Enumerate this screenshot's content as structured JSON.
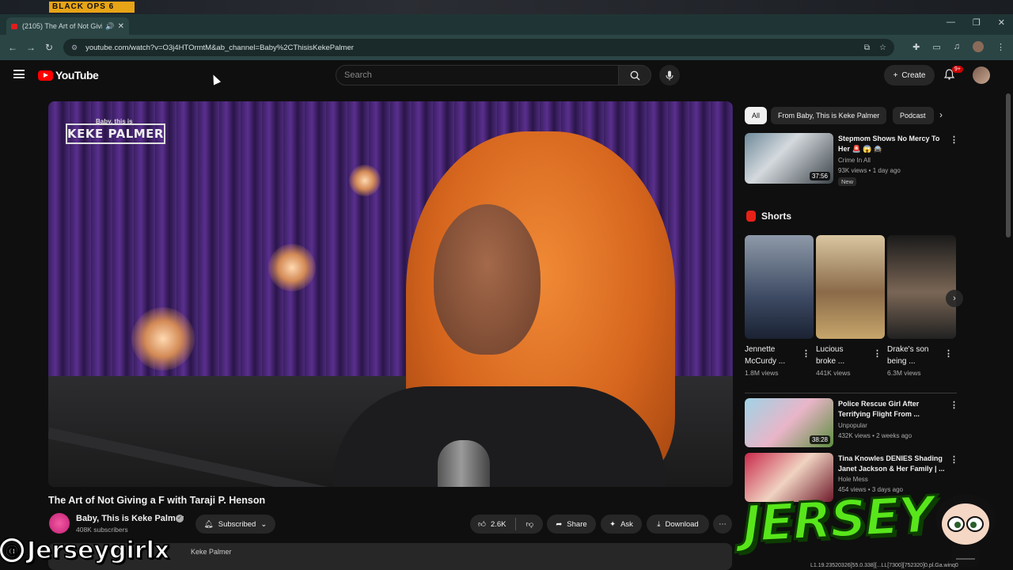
{
  "desktop": {
    "game_logo": "BLACK OPS 6"
  },
  "browser": {
    "tab_title": "(2105) The Art of Not Giving",
    "url": "youtube.com/watch?v=O3j4HTOrmtM&ab_channel=Baby%2CThisisKekePalmer"
  },
  "yt_header": {
    "logo_text": "YouTube",
    "search_placeholder": "Search",
    "create_label": "Create",
    "notification_count": "9+"
  },
  "player": {
    "logo_super": "Baby, this is",
    "logo_main": "KEKE PALMER"
  },
  "video": {
    "title": "The Art of Not Giving a F with Taraji P. Henson",
    "channel_name": "Baby, This is Keke Palmer",
    "subscribers": "408K subscribers",
    "subscribed_label": "Subscribed",
    "likes": "2.6K",
    "share_label": "Share",
    "ask_label": "Ask",
    "download_label": "Download",
    "description_snippet": "Keke Palmer"
  },
  "chips": [
    "All",
    "From Baby, This is Keke Palmer",
    "Podcast"
  ],
  "recommendations": [
    {
      "title_line1": "Stepmom Shows No Mercy To",
      "title_line2": "Her 🚨 😱 🚔",
      "channel": "Crime In All",
      "meta": "93K views • 1 day ago",
      "duration": "37:56",
      "badge": "New"
    },
    {
      "title_line1": "Police Rescue Girl After",
      "title_line2": "Terrifying Flight From ...",
      "channel": "Unpopular",
      "meta": "432K views • 2 weeks ago",
      "duration": "38:28"
    },
    {
      "title_line1": "Tina Knowles DENIES Shading",
      "title_line2": "Janet Jackson & Her Family | ...",
      "channel": "Hole Mess",
      "meta": "454 views • 3 days ago"
    }
  ],
  "shorts": {
    "heading": "Shorts",
    "items": [
      {
        "title_line1": "Jennette",
        "title_line2": "McCurdy ...",
        "views": "1.8M views"
      },
      {
        "title_line1": "Lucious",
        "title_line2": "broke ...",
        "views": "441K views"
      },
      {
        "title_line1": "Drake's son",
        "title_line2": "being ...",
        "views": "6.3M views"
      }
    ]
  },
  "overlay": {
    "watermark": "Jerseygirlx",
    "logo_text": "JERSEY",
    "status_text": "L1.19.23520326[55.0.338][...LL[7300][752320]0.pl.Ga.winq0"
  }
}
